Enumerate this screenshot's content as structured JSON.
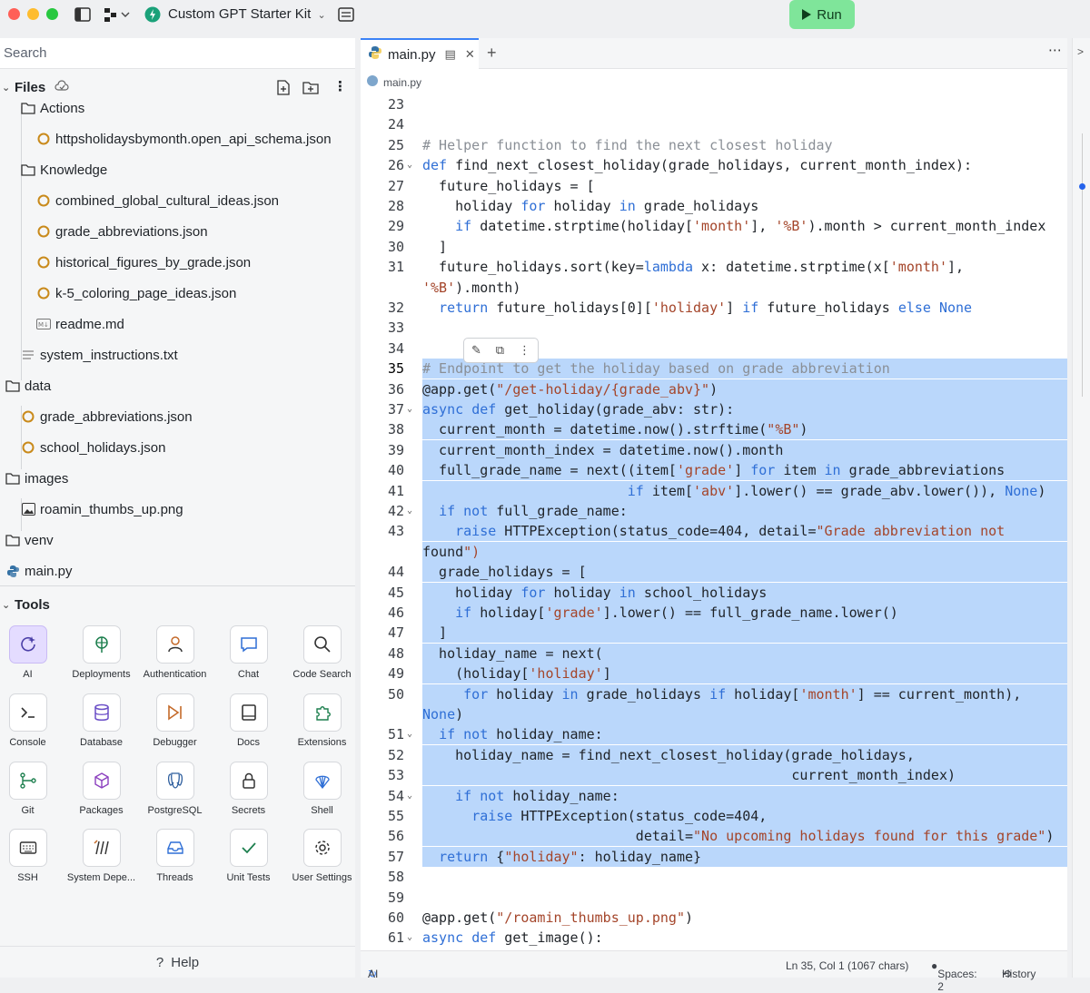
{
  "titlebar": {
    "project_name": "Custom GPT Starter Kit",
    "run_label": "Run",
    "colors": {
      "close": "#ff5f57",
      "minimize": "#febc2e",
      "zoom": "#28c840",
      "run_bg": "#7fe59a"
    }
  },
  "sidebar": {
    "search_placeholder": "Search",
    "files_label": "Files",
    "tree": [
      {
        "label": "Actions",
        "icon": "folder-icon",
        "depth": 1
      },
      {
        "label": "httpsholidaysbymonth.open_api_schema.json",
        "icon": "json-icon",
        "depth": 2
      },
      {
        "label": "Knowledge",
        "icon": "folder-icon",
        "depth": 1
      },
      {
        "label": "combined_global_cultural_ideas.json",
        "icon": "json-icon",
        "depth": 2
      },
      {
        "label": "grade_abbreviations.json",
        "icon": "json-icon",
        "depth": 2
      },
      {
        "label": "historical_figures_by_grade.json",
        "icon": "json-icon",
        "depth": 2
      },
      {
        "label": "k-5_coloring_page_ideas.json",
        "icon": "json-icon",
        "depth": 2
      },
      {
        "label": "readme.md",
        "icon": "markdown-icon",
        "depth": 2
      },
      {
        "label": "system_instructions.txt",
        "icon": "text-file-icon",
        "depth": 1
      },
      {
        "label": "data",
        "icon": "folder-icon",
        "depth": 0
      },
      {
        "label": "grade_abbreviations.json",
        "icon": "json-icon",
        "depth": 1
      },
      {
        "label": "school_holidays.json",
        "icon": "json-icon",
        "depth": 1
      },
      {
        "label": "images",
        "icon": "folder-icon",
        "depth": 0
      },
      {
        "label": "roamin_thumbs_up.png",
        "icon": "image-icon",
        "depth": 1
      },
      {
        "label": "venv",
        "icon": "folder-icon",
        "depth": 0
      },
      {
        "label": "main.py",
        "icon": "python-icon",
        "depth": 0
      }
    ],
    "tools_label": "Tools",
    "tools": [
      {
        "label": "AI",
        "icon": "ai-icon"
      },
      {
        "label": "Deployments",
        "icon": "deployments-icon"
      },
      {
        "label": "Authentication",
        "icon": "user-icon"
      },
      {
        "label": "Chat",
        "icon": "chat-icon"
      },
      {
        "label": "Code Search",
        "icon": "search-icon"
      },
      {
        "label": "Console",
        "icon": "console-icon"
      },
      {
        "label": "Database",
        "icon": "database-icon"
      },
      {
        "label": "Debugger",
        "icon": "debugger-icon"
      },
      {
        "label": "Docs",
        "icon": "book-icon"
      },
      {
        "label": "Extensions",
        "icon": "puzzle-icon"
      },
      {
        "label": "Git",
        "icon": "git-icon"
      },
      {
        "label": "Packages",
        "icon": "package-icon"
      },
      {
        "label": "PostgreSQL",
        "icon": "postgres-icon"
      },
      {
        "label": "Secrets",
        "icon": "lock-icon"
      },
      {
        "label": "Shell",
        "icon": "shell-icon"
      },
      {
        "label": "SSH",
        "icon": "keyboard-icon"
      },
      {
        "label": "System Depe...",
        "icon": "dependencies-icon"
      },
      {
        "label": "Threads",
        "icon": "inbox-icon"
      },
      {
        "label": "Unit Tests",
        "icon": "check-icon"
      },
      {
        "label": "User Settings",
        "icon": "gear-icon"
      }
    ],
    "help_label": "Help"
  },
  "editor": {
    "tab_label": "main.py",
    "breadcrumb": "main.py",
    "lines": [
      {
        "n": "23",
        "text": "",
        "hl": false,
        "fold": false
      },
      {
        "n": "24",
        "text": "",
        "hl": false,
        "fold": false
      },
      {
        "n": "25",
        "text": "# Helper function to find the next closest holiday",
        "hl": false,
        "fold": false
      },
      {
        "n": "26",
        "text": "def find_next_closest_holiday(grade_holidays, current_month_index):",
        "hl": false,
        "fold": true
      },
      {
        "n": "27",
        "text": "  future_holidays = [",
        "hl": false,
        "fold": false
      },
      {
        "n": "28",
        "text": "    holiday for holiday in grade_holidays",
        "hl": false,
        "fold": false
      },
      {
        "n": "29",
        "text": "    if datetime.strptime(holiday['month'], '%B').month > current_month_index",
        "hl": false,
        "fold": false
      },
      {
        "n": "30",
        "text": "  ]",
        "hl": false,
        "fold": false
      },
      {
        "n": "31",
        "text": "  future_holidays.sort(key=lambda x: datetime.strptime(x['month'],",
        "hl": false,
        "fold": false
      },
      {
        "n": "",
        "text": "'%B').month)",
        "hl": false,
        "fold": false
      },
      {
        "n": "32",
        "text": "  return future_holidays[0]['holiday'] if future_holidays else None",
        "hl": false,
        "fold": false
      },
      {
        "n": "33",
        "text": "",
        "hl": false,
        "fold": false
      },
      {
        "n": "34",
        "text": "",
        "hl": false,
        "fold": false
      },
      {
        "n": "35",
        "text": "# Endpoint to get the holiday based on grade abbreviation",
        "hl": true,
        "fold": false
      },
      {
        "n": "36",
        "text": "@app.get(\"/get-holiday/{grade_abv}\")",
        "hl": true,
        "fold": false
      },
      {
        "n": "37",
        "text": "async def get_holiday(grade_abv: str):",
        "hl": true,
        "fold": true
      },
      {
        "n": "38",
        "text": "  current_month = datetime.now().strftime(\"%B\")",
        "hl": true,
        "fold": false
      },
      {
        "n": "39",
        "text": "  current_month_index = datetime.now().month",
        "hl": true,
        "fold": false
      },
      {
        "n": "40",
        "text": "  full_grade_name = next((item['grade'] for item in grade_abbreviations",
        "hl": true,
        "fold": false
      },
      {
        "n": "41",
        "text": "                         if item['abv'].lower() == grade_abv.lower()), None)",
        "hl": true,
        "fold": false
      },
      {
        "n": "42",
        "text": "  if not full_grade_name:",
        "hl": true,
        "fold": true
      },
      {
        "n": "43",
        "text": "    raise HTTPException(status_code=404, detail=\"Grade abbreviation not",
        "hl": true,
        "fold": false
      },
      {
        "n": "",
        "text": "found\")",
        "hl": true,
        "fold": false
      },
      {
        "n": "44",
        "text": "  grade_holidays = [",
        "hl": true,
        "fold": false
      },
      {
        "n": "45",
        "text": "    holiday for holiday in school_holidays",
        "hl": true,
        "fold": false
      },
      {
        "n": "46",
        "text": "    if holiday['grade'].lower() == full_grade_name.lower()",
        "hl": true,
        "fold": false
      },
      {
        "n": "47",
        "text": "  ]",
        "hl": true,
        "fold": false
      },
      {
        "n": "48",
        "text": "  holiday_name = next(",
        "hl": true,
        "fold": false
      },
      {
        "n": "49",
        "text": "    (holiday['holiday']",
        "hl": true,
        "fold": false
      },
      {
        "n": "50",
        "text": "     for holiday in grade_holidays if holiday['month'] == current_month),",
        "hl": true,
        "fold": false
      },
      {
        "n": "",
        "text": "None)",
        "hl": true,
        "fold": false
      },
      {
        "n": "51",
        "text": "  if not holiday_name:",
        "hl": true,
        "fold": true
      },
      {
        "n": "52",
        "text": "    holiday_name = find_next_closest_holiday(grade_holidays,",
        "hl": true,
        "fold": false
      },
      {
        "n": "53",
        "text": "                                             current_month_index)",
        "hl": true,
        "fold": false
      },
      {
        "n": "54",
        "text": "    if not holiday_name:",
        "hl": true,
        "fold": true
      },
      {
        "n": "55",
        "text": "      raise HTTPException(status_code=404,",
        "hl": true,
        "fold": false
      },
      {
        "n": "56",
        "text": "                          detail=\"No upcoming holidays found for this grade\")",
        "hl": true,
        "fold": false
      },
      {
        "n": "57",
        "text": "  return {\"holiday\": holiday_name}",
        "hl": true,
        "fold": false
      },
      {
        "n": "58",
        "text": "",
        "hl": false,
        "fold": false
      },
      {
        "n": "59",
        "text": "",
        "hl": false,
        "fold": false
      },
      {
        "n": "60",
        "text": "@app.get(\"/roamin_thumbs_up.png\")",
        "hl": false,
        "fold": false
      },
      {
        "n": "61",
        "text": "async def get_image():",
        "hl": false,
        "fold": true
      }
    ],
    "status": {
      "ai_label": "AI",
      "cursor": "Ln 35, Col 1 (1067 chars)",
      "spaces": "Spaces: 2",
      "history": "History"
    },
    "colors": {
      "selection": "#bad7fb",
      "keyword": "#2f6fd6",
      "string": "#a4452a",
      "comment": "#8a8f96"
    }
  }
}
